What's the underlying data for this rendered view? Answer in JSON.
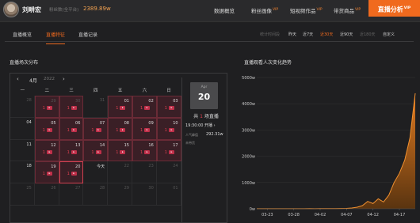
{
  "header": {
    "name": "刘畊宏",
    "fans_label": "粉丝数(全平台)",
    "fans_value": "2389.89w",
    "nav": [
      {
        "label": "数据概览",
        "vip": ""
      },
      {
        "label": "粉丝画像",
        "vip": "VIP"
      },
      {
        "label": "短视频作品",
        "vip": "VIP"
      },
      {
        "label": "带货商品",
        "vip": "VIP"
      }
    ],
    "nav_active": {
      "label": "直播分析",
      "vip": "VIP"
    }
  },
  "subnav": {
    "tabs": [
      "直播概览",
      "直播特征",
      "直播记录"
    ],
    "active_tab": "直播特征",
    "range_label": "统计时间段",
    "ranges": [
      "昨天",
      "近7天",
      "近30天",
      "近90天",
      "近180天",
      "自定义"
    ],
    "active_range": "近30天",
    "muted_range": "近180天"
  },
  "calendar": {
    "title": "直播场次分布",
    "prev": "‹",
    "next": "›",
    "month": "4月",
    "year": "2022",
    "weekdays": [
      "一",
      "二",
      "三",
      "四",
      "五",
      "六",
      "日"
    ],
    "cells": [
      {
        "day": "28",
        "other": true,
        "count": "",
        "live": false
      },
      {
        "day": "29",
        "other": true,
        "count": "1",
        "live": true
      },
      {
        "day": "30",
        "other": true,
        "count": "1",
        "live": true
      },
      {
        "day": "31",
        "other": true,
        "count": "",
        "live": false
      },
      {
        "day": "01",
        "other": false,
        "count": "1",
        "live": true
      },
      {
        "day": "02",
        "other": false,
        "count": "1",
        "live": true
      },
      {
        "day": "03",
        "other": false,
        "count": "1",
        "live": true
      },
      {
        "day": "04",
        "other": false,
        "count": "",
        "live": false
      },
      {
        "day": "05",
        "other": false,
        "count": "1",
        "live": true
      },
      {
        "day": "06",
        "other": false,
        "count": "1",
        "live": true
      },
      {
        "day": "07",
        "other": false,
        "count": "1",
        "live": true
      },
      {
        "day": "08",
        "other": false,
        "count": "1",
        "live": true
      },
      {
        "day": "09",
        "other": false,
        "count": "1",
        "live": true
      },
      {
        "day": "10",
        "other": false,
        "count": "1",
        "live": true
      },
      {
        "day": "11",
        "other": false,
        "count": "",
        "live": false
      },
      {
        "day": "12",
        "other": false,
        "count": "1",
        "live": true
      },
      {
        "day": "13",
        "other": false,
        "count": "1",
        "live": true
      },
      {
        "day": "14",
        "other": false,
        "count": "1",
        "live": true
      },
      {
        "day": "15",
        "other": false,
        "count": "1",
        "live": true
      },
      {
        "day": "16",
        "other": false,
        "count": "1",
        "live": true
      },
      {
        "day": "17",
        "other": false,
        "count": "1",
        "live": true
      },
      {
        "day": "18",
        "other": false,
        "count": "",
        "live": false
      },
      {
        "day": "19",
        "other": false,
        "count": "1",
        "live": true
      },
      {
        "day": "20",
        "other": false,
        "count": "1",
        "live": true,
        "selected": true
      },
      {
        "day": "今天",
        "other": false,
        "count": "",
        "live": false,
        "today": true
      },
      {
        "day": "22",
        "other": true,
        "count": "",
        "live": false
      },
      {
        "day": "23",
        "other": true,
        "count": "",
        "live": false
      },
      {
        "day": "24",
        "other": true,
        "count": "",
        "live": false
      },
      {
        "day": "25",
        "other": true,
        "count": "",
        "live": false
      },
      {
        "day": "26",
        "other": true,
        "count": "",
        "live": false
      },
      {
        "day": "27",
        "other": true,
        "count": "",
        "live": false
      },
      {
        "day": "28",
        "other": true,
        "count": "",
        "live": false
      },
      {
        "day": "29",
        "other": true,
        "count": "",
        "live": false
      },
      {
        "day": "30",
        "other": true,
        "count": "",
        "live": false
      },
      {
        "day": "01",
        "other": true,
        "count": "",
        "live": false
      }
    ],
    "tag_text": "直播"
  },
  "side": {
    "month": "Apr",
    "day": "20",
    "count_prefix": "共",
    "count": "1",
    "count_suffix": "场直播",
    "time": "19:30:00 开播",
    "pop_label": "人气峰值",
    "pop_value": "292.31w",
    "sales": "未带货"
  },
  "colors": {
    "accent": "#f06a1e",
    "live_red": "#e04050",
    "area_fill": "#c56a1a"
  },
  "chart_data": {
    "type": "area",
    "title": "直播观看人次变化趋势",
    "x_ticks": [
      "03-23",
      "03-28",
      "04-02",
      "04-07",
      "04-12",
      "04-17"
    ],
    "y_ticks": [
      "0w",
      "1000w",
      "2000w",
      "3000w",
      "4000w",
      "5000w"
    ],
    "ylim": [
      0,
      5000
    ],
    "x": [
      "03-21",
      "03-22",
      "03-23",
      "03-24",
      "03-25",
      "03-26",
      "03-27",
      "03-28",
      "03-29",
      "03-30",
      "03-31",
      "04-01",
      "04-02",
      "04-03",
      "04-04",
      "04-05",
      "04-06",
      "04-07",
      "04-08",
      "04-09",
      "04-10",
      "04-11",
      "04-12",
      "04-13",
      "04-14",
      "04-15",
      "04-16",
      "04-17",
      "04-18",
      "04-19",
      "04-20"
    ],
    "values": [
      2,
      2,
      2,
      2,
      3,
      2,
      3,
      3,
      4,
      3,
      5,
      4,
      6,
      5,
      8,
      7,
      12,
      15,
      30,
      60,
      120,
      280,
      200,
      380,
      260,
      520,
      1000,
      1350,
      1850,
      2700,
      4400
    ]
  }
}
